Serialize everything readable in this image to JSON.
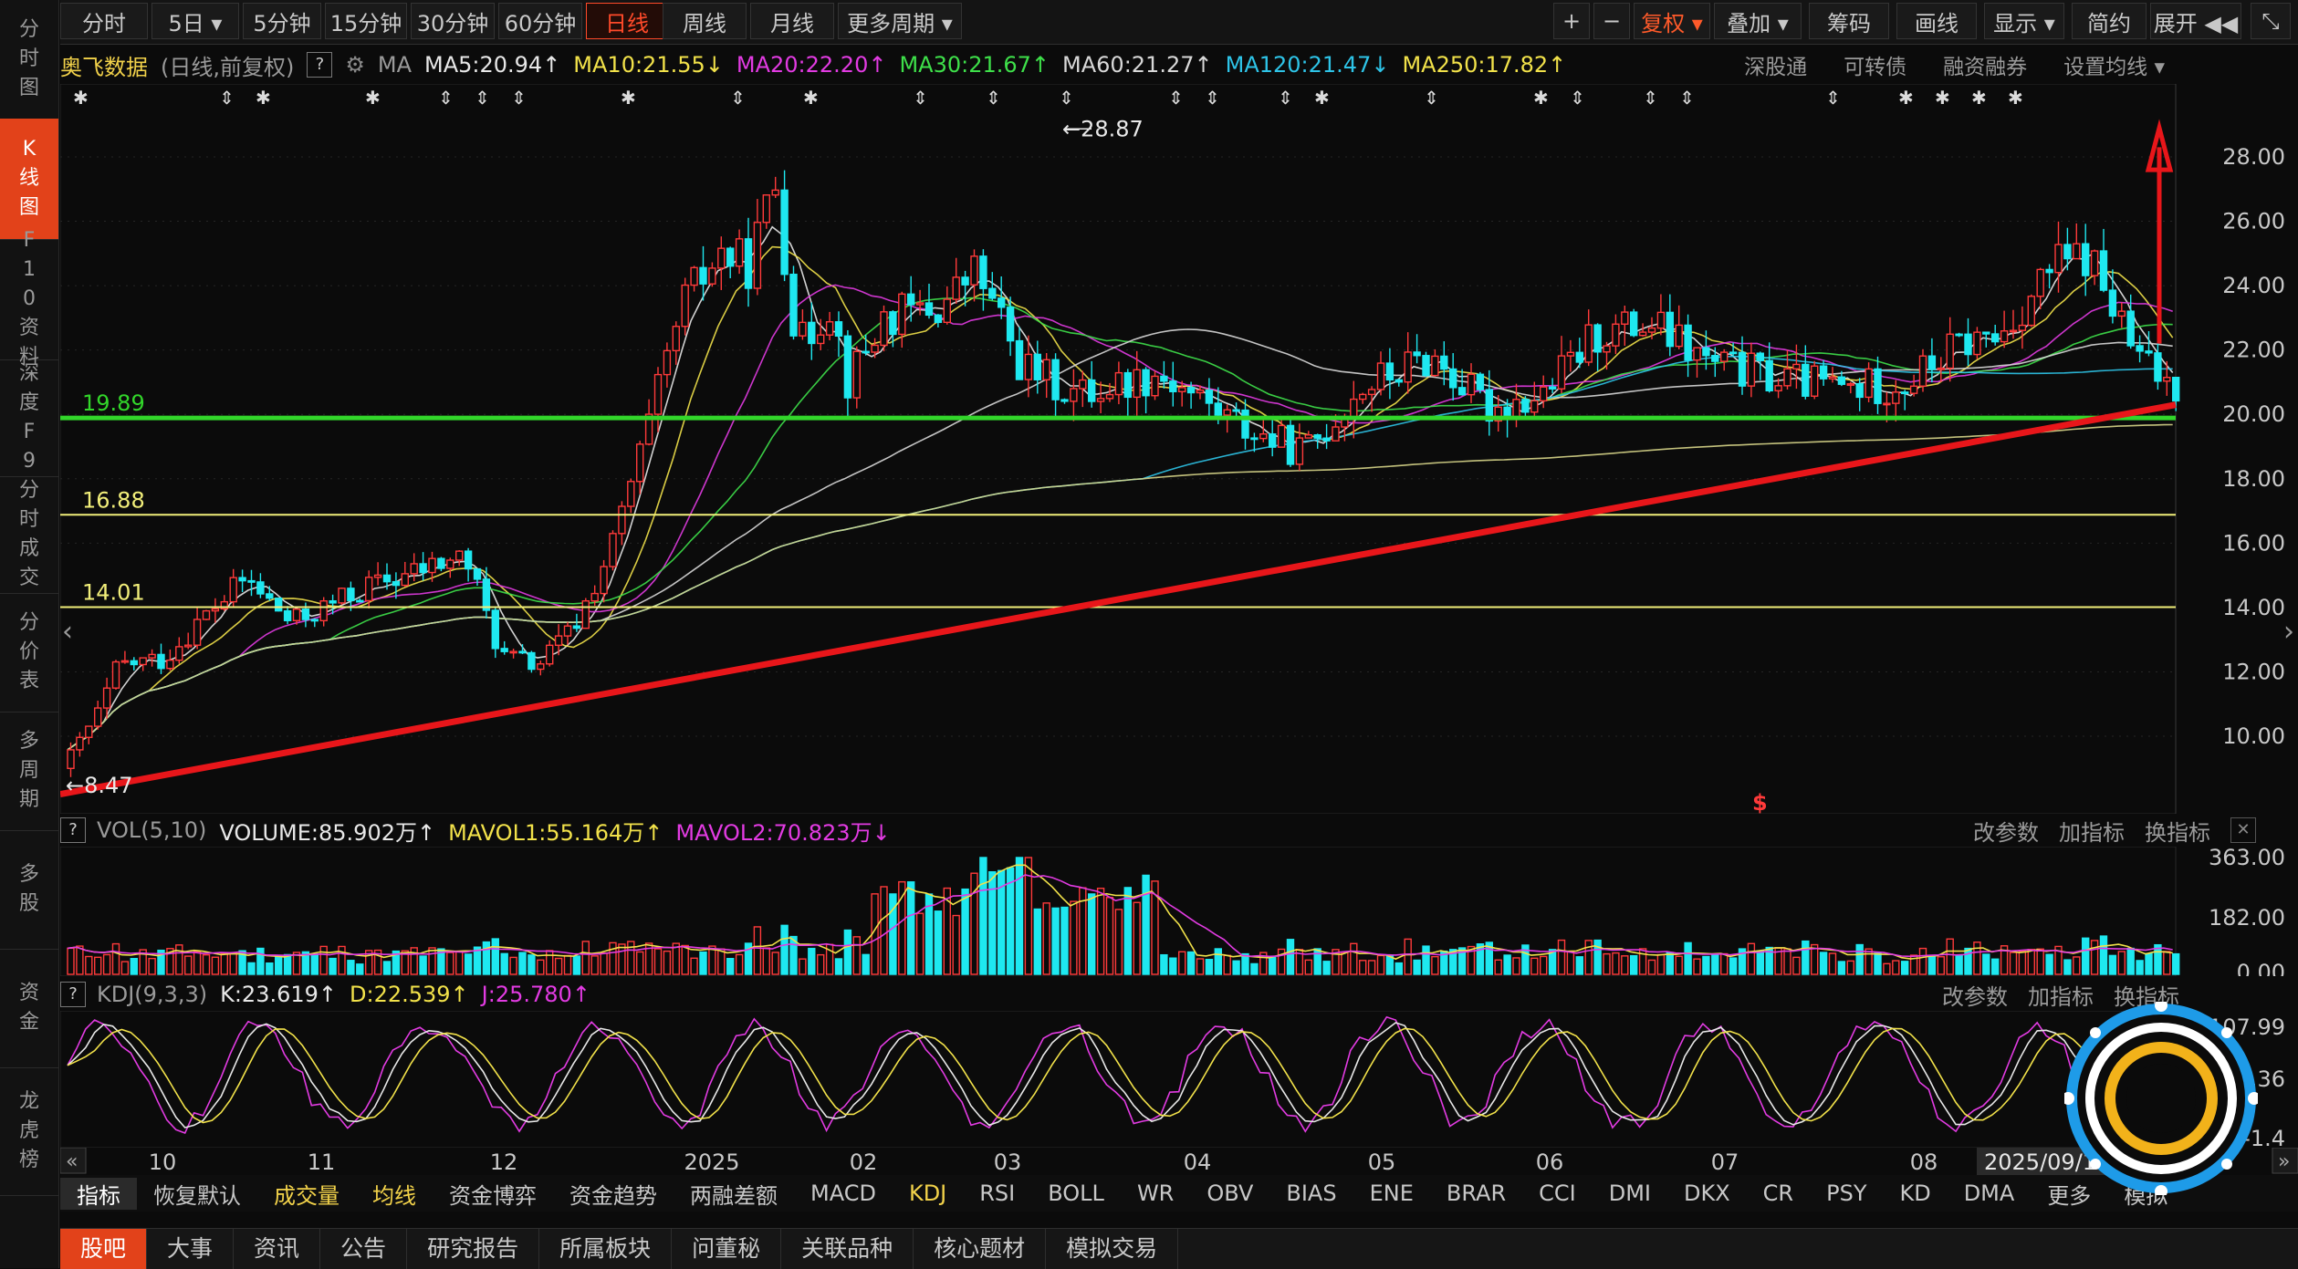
{
  "left_nav": [
    "分时图",
    "K线图",
    "F10资料",
    "深度F9",
    "分时成交",
    "分价表",
    "多周期",
    "多股",
    "资金",
    "龙虎榜"
  ],
  "toolbar": {
    "periods": [
      "分时",
      "5日",
      "5分钟",
      "15分钟",
      "30分钟",
      "60分钟",
      "日线",
      "周线",
      "月线",
      "更多周期"
    ],
    "active_period": "日线",
    "right_tools": [
      "+",
      "−",
      "复权",
      "叠加",
      "筹码",
      "画线",
      "显示",
      "简约",
      "展开"
    ]
  },
  "info": {
    "stock_name": "奥飞数据",
    "mode": "(日线,前复权)",
    "ma_label": "MA",
    "ma": [
      {
        "text": "MA5:20.94↑",
        "color": "#e8e8e8"
      },
      {
        "text": "MA10:21.55↓",
        "color": "#f2e24a"
      },
      {
        "text": "MA20:22.20↑",
        "color": "#e23be2"
      },
      {
        "text": "MA30:21.67↑",
        "color": "#3ee04a"
      },
      {
        "text": "MA60:21.27↑",
        "color": "#d8d8d8"
      },
      {
        "text": "MA120:21.47↓",
        "color": "#2ec4e8"
      },
      {
        "text": "MA250:17.82↑",
        "color": "#f2e24a"
      }
    ],
    "links": [
      "深股通",
      "可转债",
      "融资融券",
      "设置均线 ▾"
    ]
  },
  "price_chart": {
    "y_ticks": [
      "28.00",
      "26.00",
      "24.00",
      "22.00",
      "20.00",
      "18.00",
      "16.00",
      "14.00",
      "12.00",
      "10.00"
    ],
    "high_label": "28.87",
    "low_label": "8.47",
    "levels": [
      {
        "label": "19.89",
        "color": "#32d62a"
      },
      {
        "label": "16.88",
        "color": "#f2ef7a"
      },
      {
        "label": "14.01",
        "color": "#f2ef7a"
      }
    ]
  },
  "volume": {
    "title": "VOL(5,10)",
    "volume": "VOLUME:85.902万↑",
    "mavol1": "MAVOL1:55.164万↑",
    "mavol2": "MAVOL2:70.823万↓",
    "y_ticks": [
      "363.00",
      "182.00",
      "0.00"
    ],
    "actions": [
      "改参数",
      "加指标",
      "换指标"
    ]
  },
  "kdj": {
    "title": "KDJ(9,3,3)",
    "k": "K:23.619↑",
    "d": "D:22.539↑",
    "j": "J:25.780↑",
    "actions": [
      "改参数",
      "加指标",
      "换指标"
    ],
    "y_ticks": [
      "107.99",
      "53.36",
      "-1.4"
    ]
  },
  "x_axis": {
    "labels": [
      "10",
      "11",
      "12",
      "2025",
      "02",
      "03",
      "04",
      "05",
      "06",
      "07",
      "08"
    ],
    "date_label": "2025/09/11/四"
  },
  "indicator_tabs": [
    "指标",
    "恢复默认",
    "成交量",
    "均线",
    "资金博弈",
    "资金趋势",
    "两融差额",
    "MACD",
    "KDJ",
    "RSI",
    "BOLL",
    "WR",
    "OBV",
    "BIAS",
    "ENE",
    "BRAR",
    "CCI",
    "DMI",
    "DKX",
    "CR",
    "PSY",
    "KD",
    "DMA",
    "更多",
    "模拟"
  ],
  "bottom_tabs": [
    "股吧",
    "大事",
    "资讯",
    "公告",
    "研究报告",
    "所属板块",
    "问董秘",
    "关联品种",
    "核心题材",
    "模拟交易"
  ]
}
